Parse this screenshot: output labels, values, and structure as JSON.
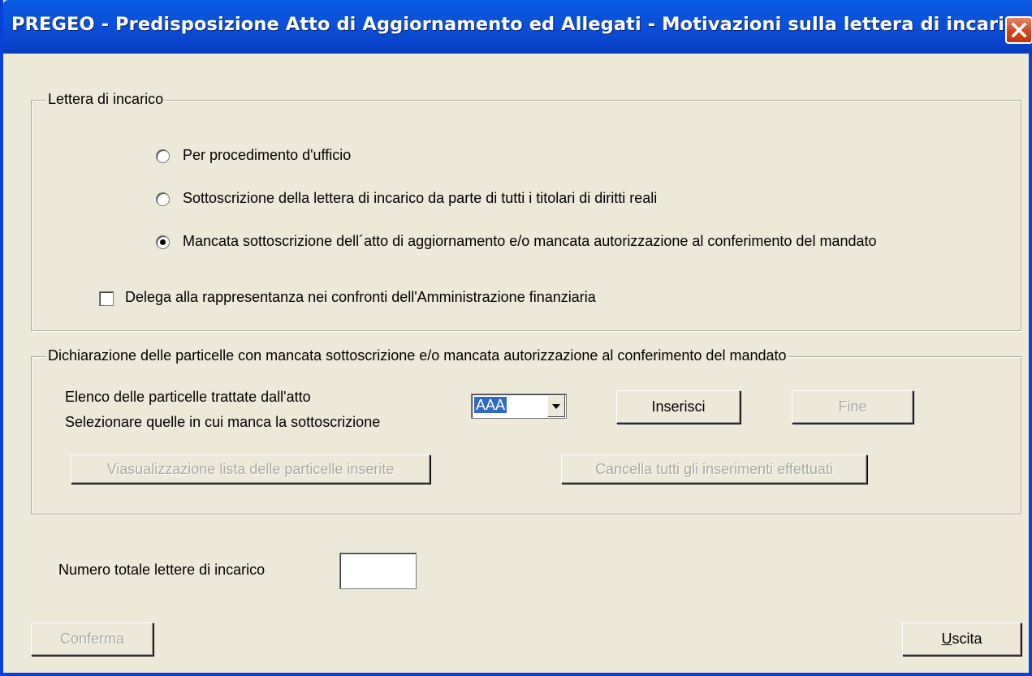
{
  "window": {
    "title": "PREGEO - Predisposizione Atto di Aggiornamento ed Allegati - Motivazioni sulla lettera di incarico",
    "close_icon": "close-icon",
    "colors": {
      "titlebar": "#0b4fd7",
      "close": "#d2461c",
      "face": "#ece9d8",
      "selection": "#316ac5"
    }
  },
  "lettera": {
    "legend": "Lettera di incarico",
    "options": [
      {
        "label": "Per procedimento d'ufficio",
        "checked": false
      },
      {
        "label": "Sottoscrizione della lettera di incarico da parte di tutti i titolari di diritti reali",
        "checked": false
      },
      {
        "label": "Mancata sottoscrizione dell´atto di aggiornamento e/o mancata autorizzazione al conferimento del mandato",
        "checked": true
      }
    ],
    "delega": {
      "label": "Delega alla rappresentanza nei confronti dell'Amministrazione finanziaria",
      "checked": false
    }
  },
  "dichiarazione": {
    "legend": "Dichiarazione delle particelle con mancata sottoscrizione e/o mancata autorizzazione al conferimento del mandato",
    "elenco_label": "Elenco delle particelle trattate dall'atto",
    "selezionare_label": "Selezionare quelle in cui manca la sottoscrizione",
    "combo_value": "AAA",
    "inserisci": "Inserisci",
    "fine": "Fine",
    "visualizza": "Viasualizzazione lista delle  particelle inserite",
    "cancella": "Cancella tutti gli inserimenti effettuati"
  },
  "totale": {
    "label": "Numero totale lettere di incarico",
    "value": ""
  },
  "footer": {
    "conferma": "Conferma",
    "uscita_accel": "U",
    "uscita_rest": "scita"
  }
}
